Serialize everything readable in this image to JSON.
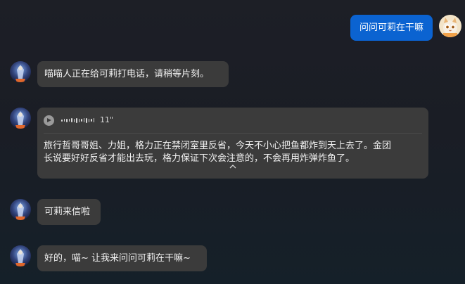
{
  "messages": [
    {
      "role": "user",
      "text": "问问可莉在干嘛"
    },
    {
      "role": "bot",
      "text": "喵喵人正在给可莉打电话，请稍等片刻。"
    },
    {
      "role": "bot",
      "voice": {
        "duration": "11\"",
        "transcript_line1": "旅行哲哥哥姐、力姐，格力正在禁闭室里反省，今天不小心把鱼都炸到天上去了。金团",
        "transcript_line2": "长说要好好反省才能出去玩，格力保证下次会注意的，不会再用炸弹炸鱼了。"
      },
      "collapse_icon": "chevron-up"
    },
    {
      "role": "bot",
      "text": "可莉来信啦"
    },
    {
      "role": "bot",
      "text": "好的，喵~ 让我来问问可莉在干嘛~"
    }
  ],
  "colors": {
    "user_bubble": "#0b63d1",
    "bot_bubble": "#3b3b3b",
    "background": "#1a1d25"
  }
}
